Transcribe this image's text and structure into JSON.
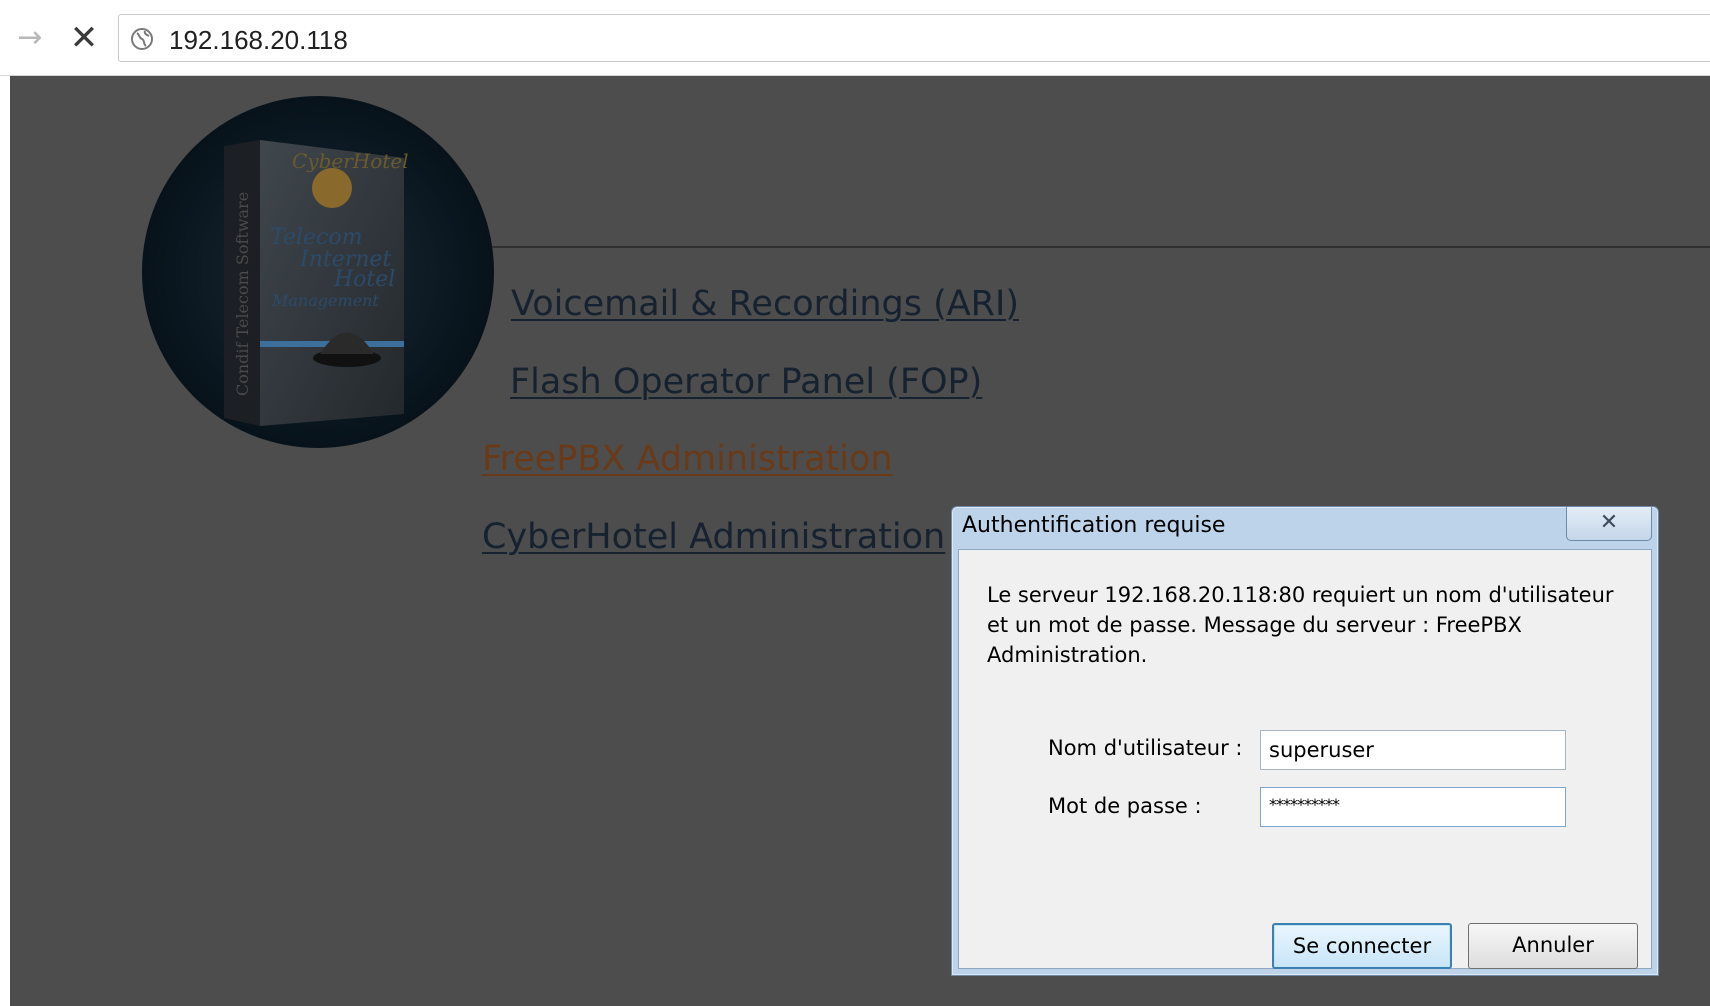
{
  "browser": {
    "forward_icon": "arrow-right-icon",
    "stop_icon": "close-icon",
    "security_icon": "globe-icon",
    "url": "192.168.20.118"
  },
  "page": {
    "background": "#4d4d4d",
    "links": {
      "ari": "Voicemail & Recordings (ARI)",
      "fop": "Flash Operator Panel (FOP)",
      "freepbx": "FreePBX Administration",
      "cyberhotel": "CyberHotel Administration"
    },
    "logo": {
      "brand": "CyberHotel",
      "lines": [
        "Telecom",
        "Internet",
        "Hotel",
        "Management"
      ],
      "spine": "Condif Telecom Software"
    }
  },
  "dialog": {
    "title": "Authentification requise",
    "close_icon": "close-icon",
    "message": "Le serveur 192.168.20.118:80 requiert un nom d'utilisateur et un mot de passe. Message du serveur : FreePBX Administration.",
    "username_label": "Nom d'utilisateur :",
    "username_value": "superuser",
    "password_label": "Mot de passe :",
    "password_value": "**********",
    "login_button": "Se connecter",
    "cancel_button": "Annuler"
  }
}
